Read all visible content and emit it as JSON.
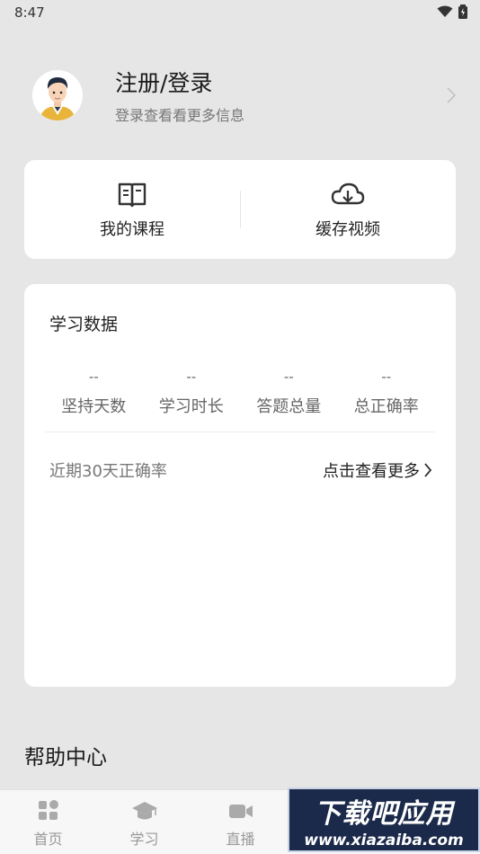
{
  "status_bar": {
    "time": "8:47"
  },
  "profile": {
    "title": "注册/登录",
    "subtitle": "登录查看看更多信息"
  },
  "quick_actions": [
    {
      "label": "我的课程",
      "icon": "book-icon"
    },
    {
      "label": "缓存视频",
      "icon": "cloud-download-icon"
    }
  ],
  "stats": {
    "title": "学习数据",
    "items": [
      {
        "value": "--",
        "label": "坚持天数"
      },
      {
        "value": "--",
        "label": "学习时长"
      },
      {
        "value": "--",
        "label": "答题总量"
      },
      {
        "value": "--",
        "label": "总正确率"
      }
    ],
    "recent_label": "近期30天正确率",
    "more_label": "点击查看更多"
  },
  "help": {
    "title": "帮助中心"
  },
  "tabbar": {
    "tabs": [
      {
        "label": "首页",
        "icon": "home-grid-icon"
      },
      {
        "label": "学习",
        "icon": "graduation-cap-icon"
      },
      {
        "label": "直播",
        "icon": "video-camera-icon"
      }
    ]
  },
  "watermark": {
    "title": "下载吧应用",
    "url": "www.xiazaiba.com"
  }
}
